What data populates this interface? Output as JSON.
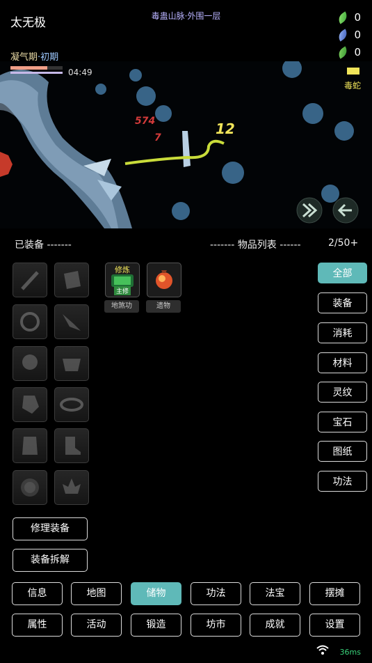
{
  "header": {
    "character_name": "太无极",
    "location": "毒蛊山脉·外围一层",
    "realm_main": "凝气期",
    "realm_sep": "·",
    "realm_sub": "初期",
    "timer": "04:49",
    "hp_fraction": 0.7,
    "exp_fraction": 1.0
  },
  "resources": [
    {
      "icon": "green-leaf-icon",
      "value": "0",
      "color": "#3fbf4a"
    },
    {
      "icon": "blue-leaf-icon",
      "value": "0",
      "color": "#3f6fd0"
    },
    {
      "icon": "green-leaf-icon",
      "value": "0",
      "color": "#3fa83a"
    }
  ],
  "enemy": {
    "name": "毒蛇",
    "color": "#f1e55a"
  },
  "battle": {
    "damage_numbers": [
      "574",
      "7",
      "12"
    ],
    "skill_icons": [
      "speed-icon",
      "exit-icon"
    ]
  },
  "inventory": {
    "equipped_label": "已装备 -------",
    "item_list_label": "------- 物品列表 ------",
    "capacity": "2/50+",
    "slot_icons": [
      "sword-slot-icon",
      "armor-slot-icon",
      "ring-slot-icon",
      "amulet-slot-icon",
      "cloak-slot-icon",
      "belt-slot-icon",
      "gloves-slot-icon",
      "bracelet-slot-icon",
      "gauntlet-slot-icon",
      "boots-slot-icon",
      "talisman-slot-icon",
      "lotus-slot-icon"
    ],
    "items": [
      {
        "name": "地煞功",
        "badge_top": "修炼",
        "badge_bottom": "主修",
        "icon": "scroll-icon"
      },
      {
        "name": "遗物",
        "icon": "relic-orb-icon"
      }
    ]
  },
  "filters": [
    "全部",
    "装备",
    "消耗",
    "材料",
    "灵纹",
    "宝石",
    "图纸",
    "功法"
  ],
  "actions": {
    "repair": "修理装备",
    "dismantle": "装备拆解"
  },
  "nav_row1": [
    "信息",
    "地图",
    "储物",
    "功法",
    "法宝",
    "摆摊"
  ],
  "nav_row2": [
    "属性",
    "活动",
    "锻造",
    "坊市",
    "成就",
    "设置"
  ],
  "status": {
    "ping": "36ms",
    "wifi_icon": "wifi-icon"
  },
  "colors": {
    "accent": "#5fb9b8",
    "ping": "#39d27a"
  }
}
